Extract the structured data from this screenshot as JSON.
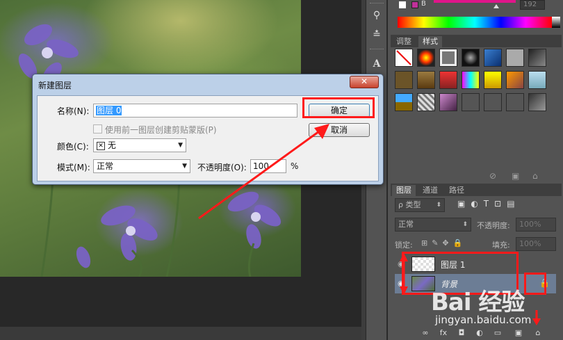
{
  "dialog": {
    "title": "新建图层",
    "close_label": "✕",
    "name_label": "名称(N):",
    "name_value": "图层 0",
    "clip_label": "使用前一图层创建剪贴蒙版(P)",
    "color_label": "颜色(C):",
    "color_value": "无",
    "color_x": "✕",
    "mode_label": "模式(M):",
    "mode_value": "正常",
    "opacity_label": "不透明度(O):",
    "opacity_value": "100",
    "opacity_unit": "%",
    "ok_label": "确定",
    "cancel_label": "取消"
  },
  "color_panel": {
    "b_label": "B",
    "b_value": "192"
  },
  "styles_panel": {
    "tabs": [
      "调整",
      "样式"
    ],
    "active_tab": "样式"
  },
  "layers_panel": {
    "tabs": [
      "图层",
      "通道",
      "路径"
    ],
    "active_tab": "图层",
    "filter_label": "ρ 类型",
    "blend_mode": "正常",
    "opacity_label": "不透明度:",
    "opacity_value": "100%",
    "lock_label": "锁定:",
    "fill_label": "填充:",
    "fill_value": "100%",
    "layers": [
      {
        "name": "图层 1",
        "italic": false
      },
      {
        "name": "背景",
        "italic": true
      }
    ]
  },
  "tools": {
    "type_tool": "A"
  },
  "watermark": {
    "logo": "Bai 经验",
    "sub": "jingyan.baidu.com"
  },
  "colors": {
    "accent_red": "#ff1a1a",
    "panel_bg": "#535353",
    "dialog_frame": "#bcd0e8"
  }
}
